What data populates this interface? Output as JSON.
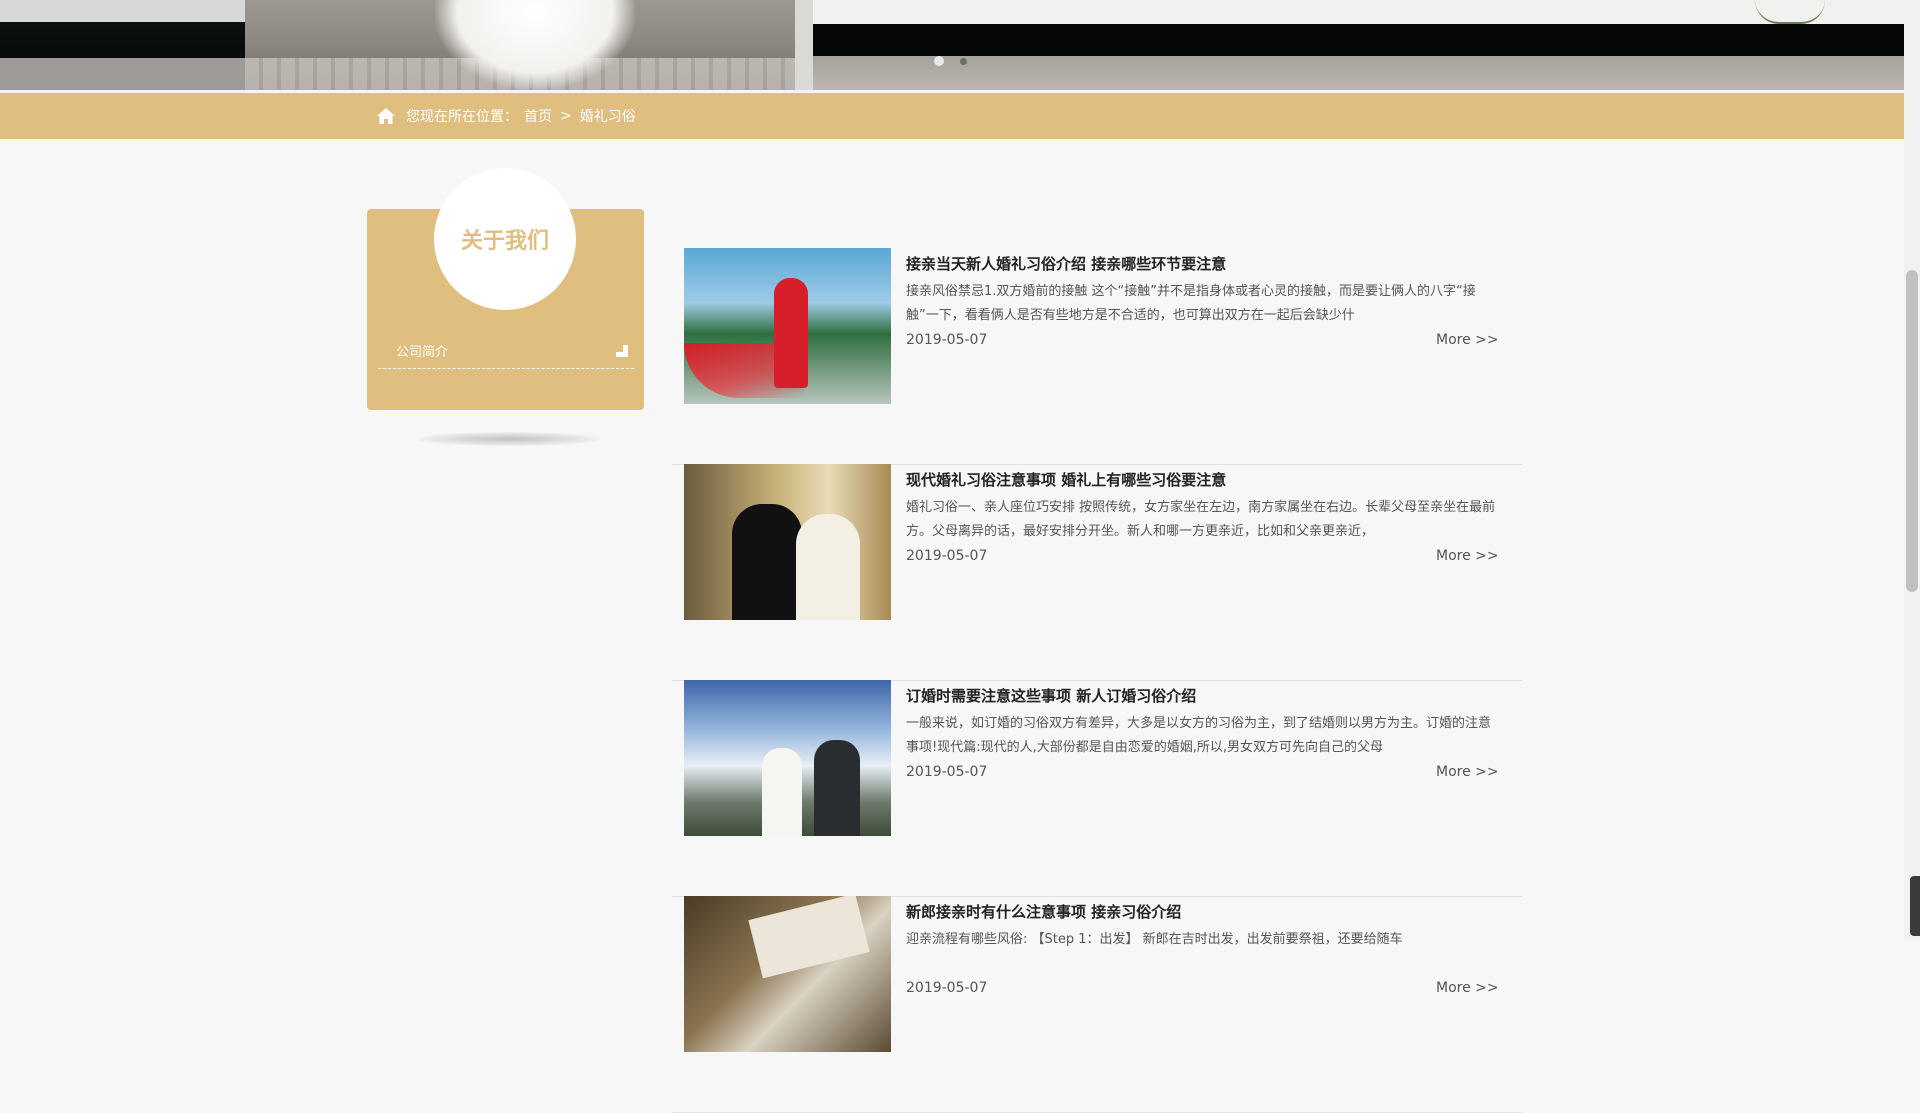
{
  "breadcrumb": {
    "prefix": "您现在所在位置：",
    "home": "首页",
    "separator": ">",
    "current": "婚礼习俗"
  },
  "sidebar": {
    "title": "关于我们",
    "items": [
      {
        "label": "公司简介"
      }
    ]
  },
  "articles": [
    {
      "title": "接亲当天新人婚礼习俗介绍 接亲哪些环节要注意",
      "desc": "    接亲风俗禁忌1.双方婚前的接触       这个“接触”并不是指身体或者心灵的接触，而是要让俩人的八字“接触”一下，看看俩人是否有些地方是不合适的，也可算出双方在一起后会缺少什",
      "date": "2019-05-07",
      "more": "More >>"
    },
    {
      "title": "现代婚礼习俗注意事项 婚礼上有哪些习俗要注意",
      "desc": "    婚礼习俗一、亲人座位巧安排       按照传统，女方家坐在左边，南方家属坐在右边。长辈父母至亲坐在最前方。父母离异的话，最好安排分开坐。新人和哪一方更亲近，比如和父亲更亲近，",
      "date": "2019-05-07",
      "more": "More >>"
    },
    {
      "title": "订婚时需要注意这些事项 新人订婚习俗介绍",
      "desc": "一般来说，如订婚的习俗双方有差异，大多是以女方的习俗为主，到了结婚则以男方为主。订婚的注意事项!现代篇:现代的人,大部份都是自由恋爱的婚姻,所以,男女双方可先向自己的父母",
      "date": "2019-05-07",
      "more": "More >>"
    },
    {
      "title": "新郎接亲时有什么注意事项 接亲习俗介绍",
      "desc": "迎亲流程有哪些风俗:        【Step 1：出发】       新郎在吉时出发，出发前要祭祖，还要给随车",
      "date": "2019-05-07",
      "more": "More >>"
    }
  ]
}
